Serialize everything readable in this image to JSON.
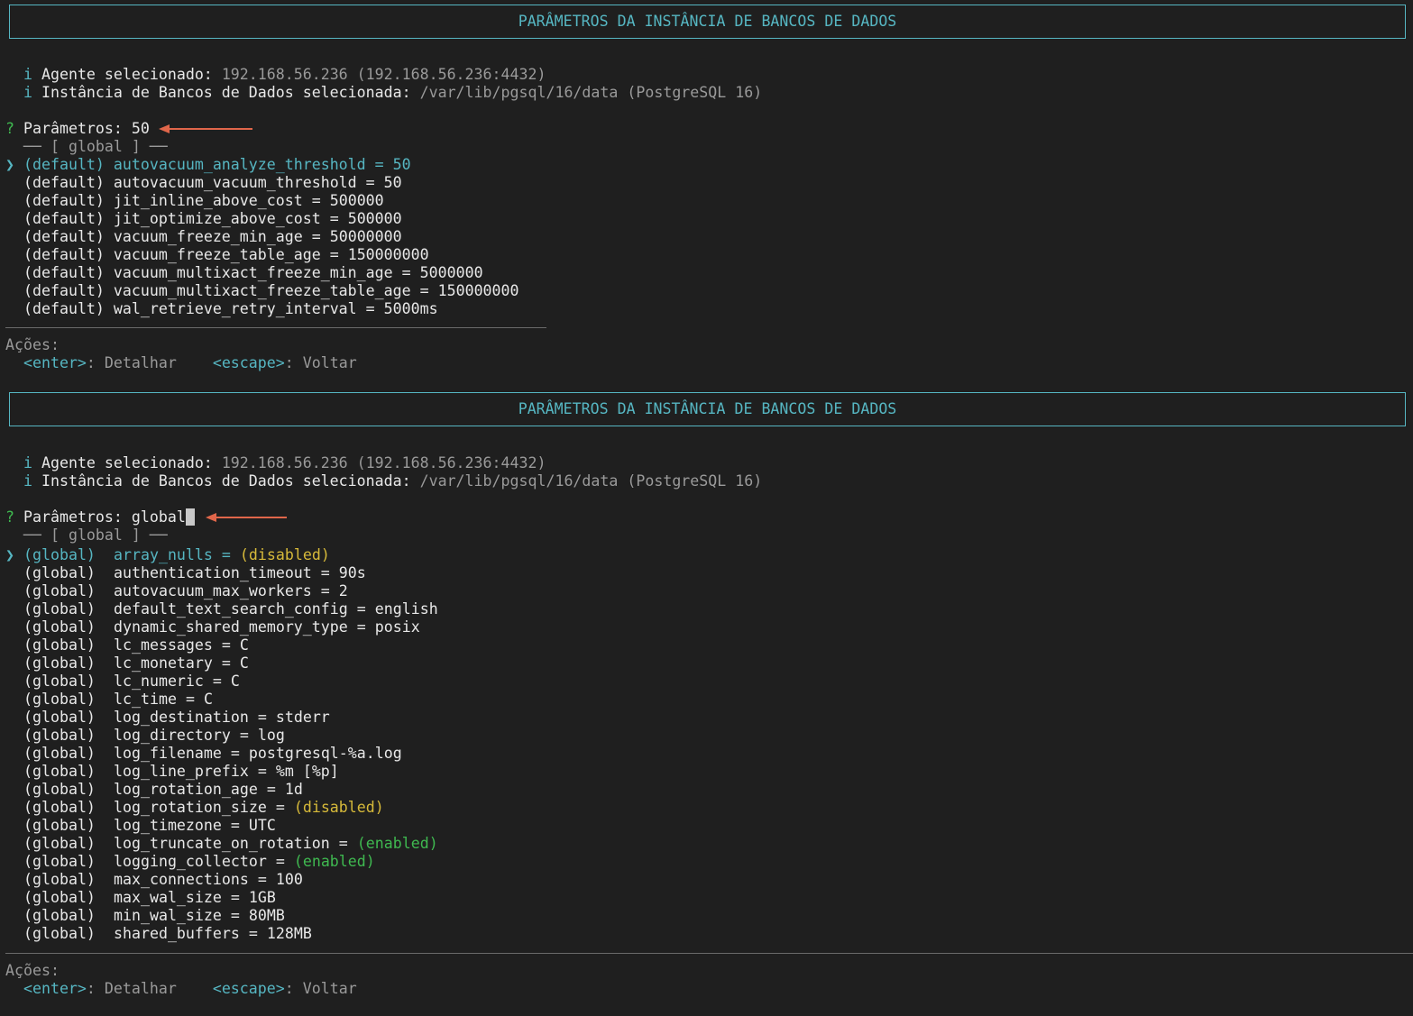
{
  "panel1": {
    "title": "PARÂMETROS DA INSTÂNCIA DE BANCOS DE DADOS",
    "info": [
      {
        "icon": "i",
        "label": "Agente selecionado:",
        "value": "192.168.56.236 (192.168.56.236:4432)"
      },
      {
        "icon": "i",
        "label": "Instância de Bancos de Dados selecionada:",
        "value": "/var/lib/pgsql/16/data (PostgreSQL 16)"
      }
    ],
    "prompt": {
      "mark": "?",
      "label": "Parâmetros:",
      "value": "50"
    },
    "group_header": "── [ global ] ──",
    "pointer": "❯",
    "rows": [
      {
        "scope": "(default)",
        "param": "autovacuum_analyze_threshold",
        "eq": "=",
        "value": "50"
      },
      {
        "scope": "(default)",
        "param": "autovacuum_vacuum_threshold",
        "eq": "=",
        "value": "50"
      },
      {
        "scope": "(default)",
        "param": "jit_inline_above_cost",
        "eq": "=",
        "value": "500000"
      },
      {
        "scope": "(default)",
        "param": "jit_optimize_above_cost",
        "eq": "=",
        "value": "500000"
      },
      {
        "scope": "(default)",
        "param": "vacuum_freeze_min_age",
        "eq": "=",
        "value": "50000000"
      },
      {
        "scope": "(default)",
        "param": "vacuum_freeze_table_age",
        "eq": "=",
        "value": "150000000"
      },
      {
        "scope": "(default)",
        "param": "vacuum_multixact_freeze_min_age",
        "eq": "=",
        "value": "5000000"
      },
      {
        "scope": "(default)",
        "param": "vacuum_multixact_freeze_table_age",
        "eq": "=",
        "value": "150000000"
      },
      {
        "scope": "(default)",
        "param": "wal_retrieve_retry_interval",
        "eq": "=",
        "value": "5000ms"
      }
    ],
    "actions_label": "Ações:",
    "actions": [
      {
        "key": "<enter>",
        "sep": ":",
        "desc": "Detalhar"
      },
      {
        "key": "<escape>",
        "sep": ":",
        "desc": "Voltar"
      }
    ]
  },
  "panel2": {
    "title": "PARÂMETROS DA INSTÂNCIA DE BANCOS DE DADOS",
    "info": [
      {
        "icon": "i",
        "label": "Agente selecionado:",
        "value": "192.168.56.236 (192.168.56.236:4432)"
      },
      {
        "icon": "i",
        "label": "Instância de Bancos de Dados selecionada:",
        "value": "/var/lib/pgsql/16/data (PostgreSQL 16)"
      }
    ],
    "prompt": {
      "mark": "?",
      "label": "Parâmetros:",
      "value": "global"
    },
    "group_header": "── [ global ] ──",
    "pointer": "❯",
    "rows": [
      {
        "scope": "(global)",
        "param": "array_nulls",
        "eq": "=",
        "value": "(disabled)",
        "value_color": "yellow"
      },
      {
        "scope": "(global)",
        "param": "authentication_timeout",
        "eq": "=",
        "value": "90s"
      },
      {
        "scope": "(global)",
        "param": "autovacuum_max_workers",
        "eq": "=",
        "value": "2"
      },
      {
        "scope": "(global)",
        "param": "default_text_search_config",
        "eq": "=",
        "value": "english"
      },
      {
        "scope": "(global)",
        "param": "dynamic_shared_memory_type",
        "eq": "=",
        "value": "posix"
      },
      {
        "scope": "(global)",
        "param": "lc_messages",
        "eq": "=",
        "value": "C"
      },
      {
        "scope": "(global)",
        "param": "lc_monetary",
        "eq": "=",
        "value": "C"
      },
      {
        "scope": "(global)",
        "param": "lc_numeric",
        "eq": "=",
        "value": "C"
      },
      {
        "scope": "(global)",
        "param": "lc_time",
        "eq": "=",
        "value": "C"
      },
      {
        "scope": "(global)",
        "param": "log_destination",
        "eq": "=",
        "value": "stderr"
      },
      {
        "scope": "(global)",
        "param": "log_directory",
        "eq": "=",
        "value": "log"
      },
      {
        "scope": "(global)",
        "param": "log_filename",
        "eq": "=",
        "value": "postgresql-%a.log"
      },
      {
        "scope": "(global)",
        "param": "log_line_prefix",
        "eq": "=",
        "value": "%m [%p]"
      },
      {
        "scope": "(global)",
        "param": "log_rotation_age",
        "eq": "=",
        "value": "1d"
      },
      {
        "scope": "(global)",
        "param": "log_rotation_size",
        "eq": "=",
        "value": "(disabled)",
        "value_color": "yellow"
      },
      {
        "scope": "(global)",
        "param": "log_timezone",
        "eq": "=",
        "value": "UTC"
      },
      {
        "scope": "(global)",
        "param": "log_truncate_on_rotation",
        "eq": "=",
        "value": "(enabled)",
        "value_color": "green"
      },
      {
        "scope": "(global)",
        "param": "logging_collector",
        "eq": "=",
        "value": "(enabled)",
        "value_color": "green"
      },
      {
        "scope": "(global)",
        "param": "max_connections",
        "eq": "=",
        "value": "100"
      },
      {
        "scope": "(global)",
        "param": "max_wal_size",
        "eq": "=",
        "value": "1GB"
      },
      {
        "scope": "(global)",
        "param": "min_wal_size",
        "eq": "=",
        "value": "80MB"
      },
      {
        "scope": "(global)",
        "param": "shared_buffers",
        "eq": "=",
        "value": "128MB"
      }
    ],
    "actions_label": "Ações:",
    "actions": [
      {
        "key": "<enter>",
        "sep": ":",
        "desc": "Detalhar"
      },
      {
        "key": "<escape>",
        "sep": ":",
        "desc": "Voltar"
      }
    ]
  },
  "colors": {
    "background": "#1f1f1f",
    "cyan": "#56b6c2",
    "gray": "#9a9a9a",
    "text": "#e8e8e8",
    "green": "#3fb950",
    "yellow": "#d7ba3a",
    "annotation_arrow": "#e0664a"
  },
  "icons": {
    "pointer": "chevron-right-icon",
    "info": "info-icon",
    "prompt": "question-icon",
    "annotation": "arrow-left-annotation-icon"
  }
}
